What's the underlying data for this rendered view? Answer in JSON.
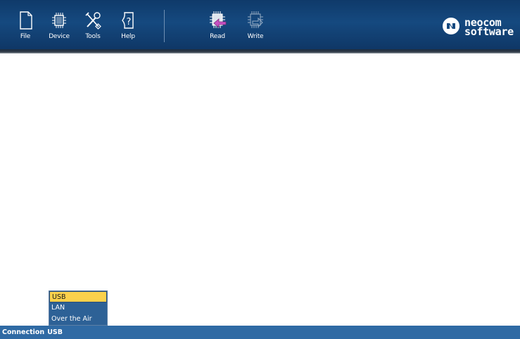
{
  "toolbar": {
    "buttons": [
      {
        "label": "File",
        "icon": "file-icon"
      },
      {
        "label": "Device",
        "icon": "device-chip-icon"
      },
      {
        "label": "Tools",
        "icon": "tools-icon"
      },
      {
        "label": "Help",
        "icon": "help-icon"
      },
      {
        "label": "Read",
        "icon": "read-from-device-icon"
      },
      {
        "label": "Write",
        "icon": "write-to-device-icon"
      }
    ]
  },
  "logo": {
    "line1": "neocom",
    "line2": "software"
  },
  "connection_dropdown": {
    "options": [
      "USB",
      "LAN",
      "Over the Air"
    ],
    "selected": "USB"
  },
  "statusbar": {
    "label": "Connection",
    "value": "USB"
  },
  "colors": {
    "toolbar": "#15497f",
    "statusbar": "#2f6aa4",
    "dropdown_bg": "#2d6196",
    "dropdown_selected": "#fbd14b",
    "read_arrow": "#c64fc2"
  }
}
